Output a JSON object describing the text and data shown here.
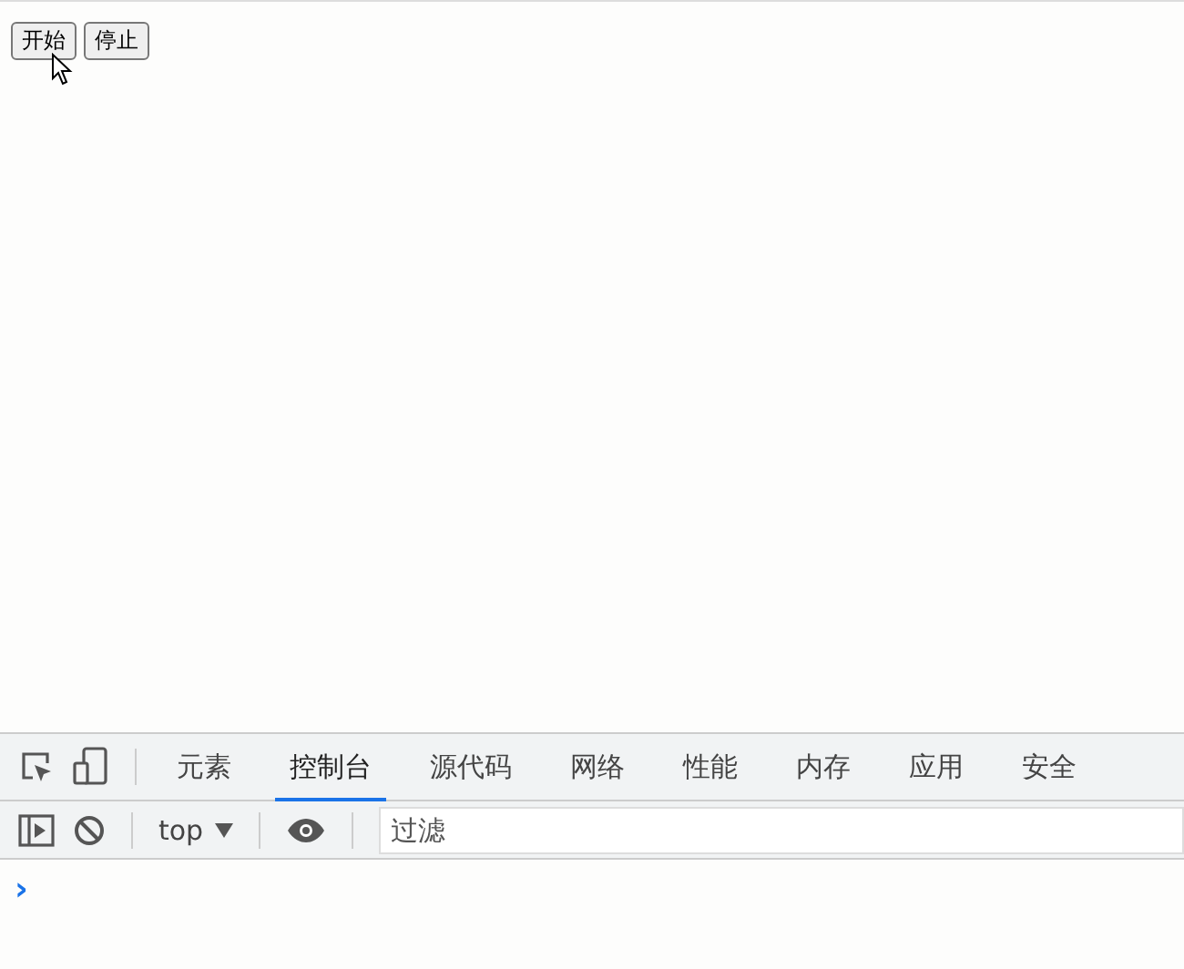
{
  "page": {
    "buttons": [
      "开始",
      "停止"
    ]
  },
  "devtools": {
    "tabs": [
      {
        "label": "元素",
        "selected": false
      },
      {
        "label": "控制台",
        "selected": true
      },
      {
        "label": "源代码",
        "selected": false
      },
      {
        "label": "网络",
        "selected": false
      },
      {
        "label": "性能",
        "selected": false
      },
      {
        "label": "内存",
        "selected": false
      },
      {
        "label": "应用",
        "selected": false
      },
      {
        "label": "安全",
        "selected": false
      }
    ],
    "context": "top",
    "filter": {
      "placeholder": "过滤"
    },
    "prompt": "›"
  }
}
